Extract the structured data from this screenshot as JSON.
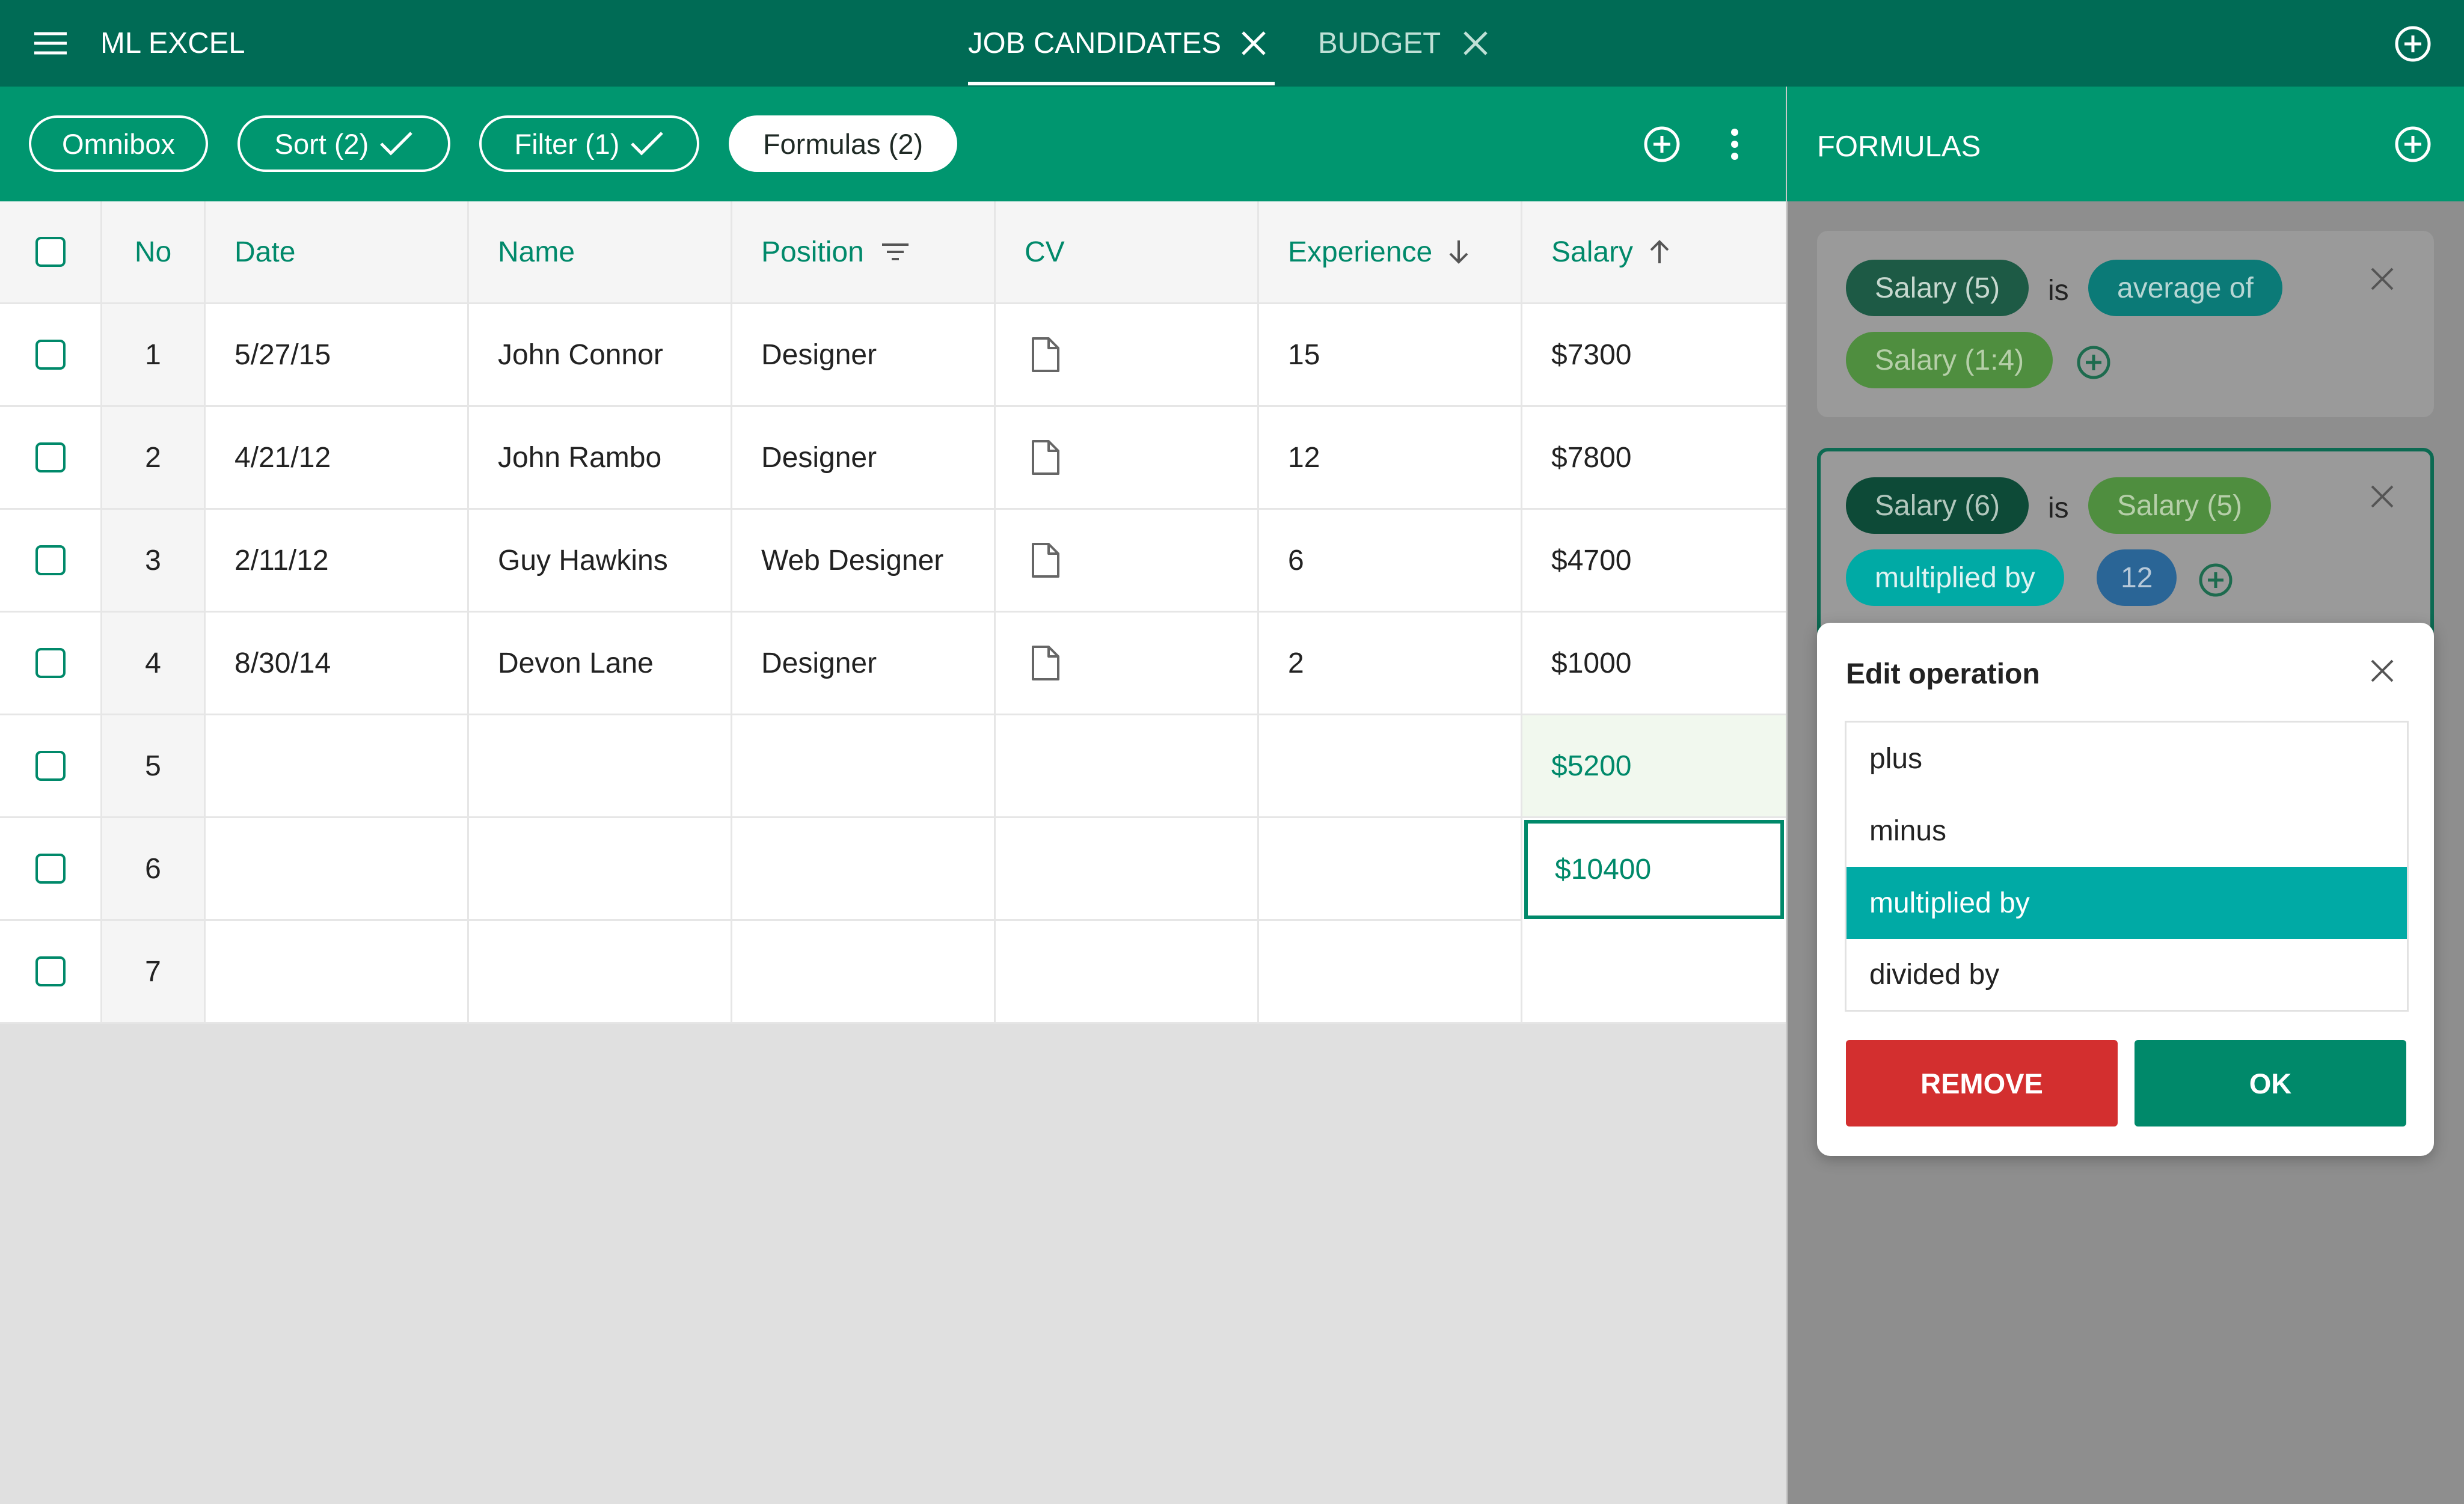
{
  "app": {
    "title": "ML EXCEL",
    "tabs": [
      {
        "label": "JOB CANDIDATES",
        "active": true
      },
      {
        "label": "BUDGET",
        "active": false
      }
    ]
  },
  "toolbar": {
    "pills": [
      {
        "label": "Omnibox",
        "checked": false
      },
      {
        "label": "Sort (2)",
        "checked": true
      },
      {
        "label": "Filter (1)",
        "checked": true
      },
      {
        "label": "Formulas (2)",
        "active": true
      }
    ]
  },
  "table": {
    "columns": [
      "No",
      "Date",
      "Name",
      "Position",
      "CV",
      "Experience",
      "Salary"
    ],
    "rows": [
      {
        "no": "1",
        "date": "5/27/15",
        "name": "John Connor",
        "position": "Designer",
        "cv": true,
        "experience": "15",
        "salary": "$7300"
      },
      {
        "no": "2",
        "date": "4/21/12",
        "name": "John Rambo",
        "position": "Designer",
        "cv": true,
        "experience": "12",
        "salary": "$7800"
      },
      {
        "no": "3",
        "date": "2/11/12",
        "name": "Guy Hawkins",
        "position": "Web Designer",
        "cv": true,
        "experience": "6",
        "salary": "$4700"
      },
      {
        "no": "4",
        "date": "8/30/14",
        "name": "Devon Lane",
        "position": "Designer",
        "cv": true,
        "experience": "2",
        "salary": "$1000"
      },
      {
        "no": "5",
        "date": "",
        "name": "",
        "position": "",
        "cv": false,
        "experience": "",
        "salary": "$5200"
      },
      {
        "no": "6",
        "date": "",
        "name": "",
        "position": "",
        "cv": false,
        "experience": "",
        "salary": "$10400"
      },
      {
        "no": "7",
        "date": "",
        "name": "",
        "position": "",
        "cv": false,
        "experience": "",
        "salary": ""
      }
    ]
  },
  "formulas_panel": {
    "title": "FORMULAS",
    "formula1": {
      "target": "Salary (5)",
      "is": "is",
      "operator": "average of",
      "operand": "Salary (1:4)"
    },
    "formula2": {
      "target": "Salary (6)",
      "is": "is",
      "operand": "Salary (5)",
      "operator": "multiplied by",
      "value": "12"
    }
  },
  "dialog": {
    "title": "Edit operation",
    "options": [
      "plus",
      "minus",
      "multiplied by",
      "divided by"
    ],
    "selected": "multiplied by",
    "remove_label": "REMOVE",
    "ok_label": "OK"
  },
  "colors": {
    "topbar": "#006b55",
    "toolbar": "#00966f",
    "accent": "#00896a",
    "selected_option": "#00aaa5",
    "remove": "#d32f2f",
    "ok": "#00896a"
  }
}
